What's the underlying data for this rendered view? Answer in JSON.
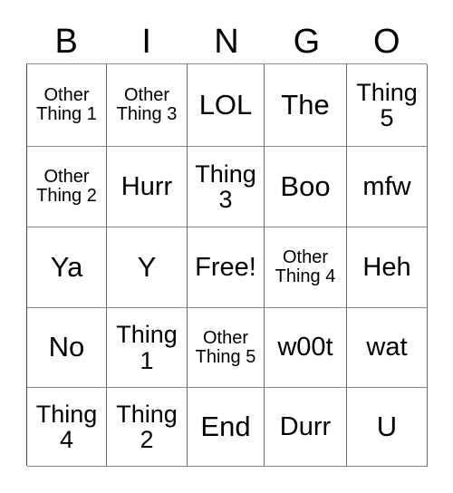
{
  "card": {
    "type": "bingo-card",
    "columns": 5,
    "rows": 5,
    "background_color": "#ffffff",
    "text_color": "#000000",
    "border_color": "#6a6a6a"
  },
  "header": {
    "letters": [
      "B",
      "I",
      "N",
      "G",
      "O"
    ]
  },
  "grid": {
    "rows": [
      [
        {
          "text": "Other Thing 1",
          "size": "sm"
        },
        {
          "text": "Other Thing 3",
          "size": "sm"
        },
        {
          "text": "LOL",
          "size": "xl"
        },
        {
          "text": "The",
          "size": "xl"
        },
        {
          "text": "Thing 5",
          "size": "md"
        }
      ],
      [
        {
          "text": "Other Thing 2",
          "size": "sm"
        },
        {
          "text": "Hurr",
          "size": "lg"
        },
        {
          "text": "Thing 3",
          "size": "md"
        },
        {
          "text": "Boo",
          "size": "xl"
        },
        {
          "text": "mfw",
          "size": "lg"
        }
      ],
      [
        {
          "text": "Ya",
          "size": "xl"
        },
        {
          "text": "Y",
          "size": "xl"
        },
        {
          "text": "Free!",
          "size": "lg"
        },
        {
          "text": "Other Thing 4",
          "size": "sm"
        },
        {
          "text": "Heh",
          "size": "lg"
        }
      ],
      [
        {
          "text": "No",
          "size": "xl"
        },
        {
          "text": "Thing 1",
          "size": "md"
        },
        {
          "text": "Other Thing 5",
          "size": "sm"
        },
        {
          "text": "w00t",
          "size": "lg"
        },
        {
          "text": "wat",
          "size": "lg"
        }
      ],
      [
        {
          "text": "Thing 4",
          "size": "md"
        },
        {
          "text": "Thing 2",
          "size": "md"
        },
        {
          "text": "End",
          "size": "xl"
        },
        {
          "text": "Durr",
          "size": "lg"
        },
        {
          "text": "U",
          "size": "xl"
        }
      ]
    ],
    "free_space": {
      "row": 2,
      "column": 2,
      "text": "Free!"
    }
  }
}
